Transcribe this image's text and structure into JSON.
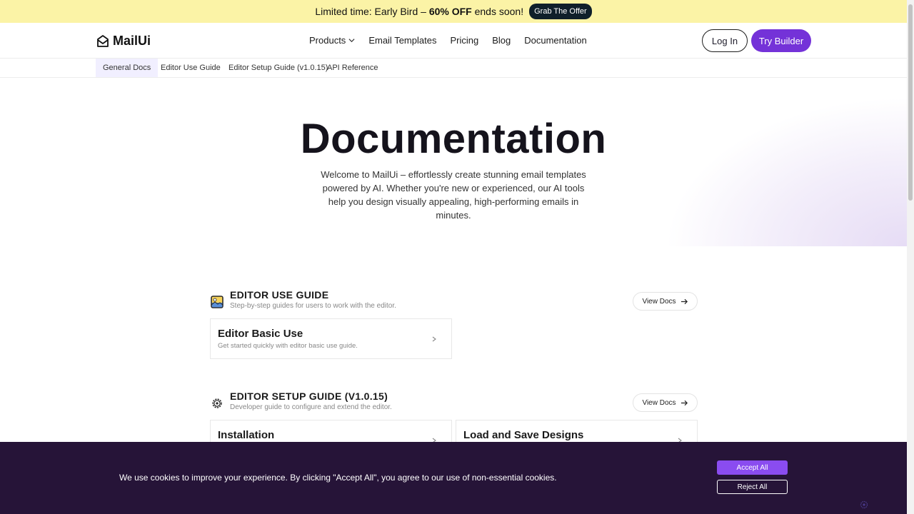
{
  "promo": {
    "text_prefix": "Limited time: Early Bird – ",
    "text_bold": "60% OFF",
    "text_suffix": " ends soon!",
    "button": "Grab The Offer"
  },
  "header": {
    "logo_text": "MailUi",
    "nav": [
      "Products",
      "Email Templates",
      "Pricing",
      "Blog",
      "Documentation"
    ],
    "login": "Log In",
    "try": "Try Builder"
  },
  "subtabs": [
    "General Docs",
    "Editor Use Guide",
    "Editor Setup Guide (v1.0.15)",
    "API Reference"
  ],
  "hero": {
    "title": "Documentation",
    "description": "Welcome to MailUi – effortlessly create stunning email templates powered by AI. Whether you're new or experienced, our AI tools help you design visually appealing, high-performing emails in minutes."
  },
  "sections": [
    {
      "title": "EDITOR USE GUIDE",
      "subtitle": "Step-by-step guides for users to work with the editor.",
      "view_docs": "View Docs",
      "icon": "image-icon",
      "cards": [
        {
          "title": "Editor Basic Use",
          "desc": "Get started quickly with editor basic use guide."
        }
      ]
    },
    {
      "title": "EDITOR SETUP GUIDE (V1.0.15)",
      "subtitle": "Developer guide to configure and extend the editor.",
      "view_docs": "View Docs",
      "icon": "gear-icon",
      "cards": [
        {
          "title": "Installation",
          "desc": ""
        },
        {
          "title": "Load and Save Designs",
          "desc": ""
        }
      ]
    }
  ],
  "cookie": {
    "text": "We use cookies to improve your experience. By clicking \"Accept All\", you agree to our use of non-essential cookies.",
    "accept": "Accept All",
    "reject": "Reject All"
  },
  "colors": {
    "promo_bg": "#fbf3a6",
    "accent": "#7432d8",
    "cookie_bg": "#261438"
  }
}
